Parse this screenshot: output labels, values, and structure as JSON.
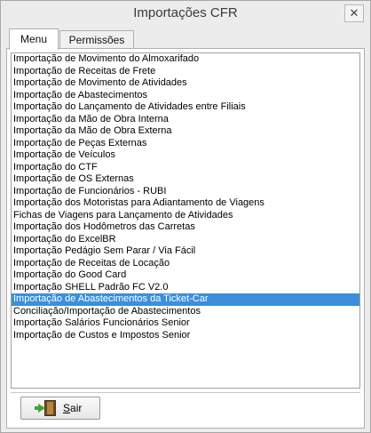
{
  "window": {
    "title": "Importações CFR",
    "close_glyph": "✕"
  },
  "tabs": [
    {
      "label": "Menu",
      "active": true
    },
    {
      "label": "Permissões",
      "active": false
    }
  ],
  "list": {
    "items": [
      "Importação de Movimento do Almoxarifado",
      "Importação de Receitas de Frete",
      "Importação de Movimento de Atividades",
      "Importação de Abastecimentos",
      "Importação do Lançamento de Atividades entre Filiais",
      "Importação da Mão de Obra Interna",
      "Importação da Mão de Obra Externa",
      "Importação de Peças Externas",
      "Importação de Veículos",
      "Importação do CTF",
      "Importação de OS Externas",
      "Importação de Funcionários - RUBI",
      "Importação dos Motoristas para Adiantamento de Viagens",
      "Fichas de Viagens para Lançamento de Atividades",
      "Importação dos Hodômetros das Carretas",
      "Importação do ExcelBR",
      "Importação Pedágio Sem Parar / Via Fácil",
      "Importação de Receitas de Locação",
      "Importação do Good Card",
      "Importação SHELL Padrão FC V2.0",
      "Importação de Abastecimentos da Ticket-Car",
      "Conciliação/Importação de Abastecimentos",
      "Importação Salários Funcionários Senior",
      "Importação de Custos e Impostos Senior"
    ],
    "selected_index": 20,
    "selection_color": "#3b8fdb"
  },
  "exit_button": {
    "label_first": "S",
    "label_rest": "air",
    "icon": "exit-door-icon"
  }
}
